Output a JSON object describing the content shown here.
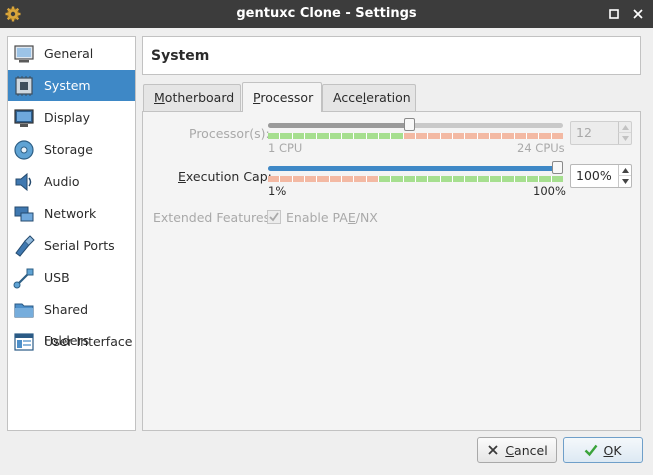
{
  "window": {
    "title": "gentuxc Clone - Settings"
  },
  "sidebar": {
    "items": [
      {
        "label": "General",
        "icon": "general-icon"
      },
      {
        "label": "System",
        "icon": "system-icon",
        "selected": true
      },
      {
        "label": "Display",
        "icon": "display-icon"
      },
      {
        "label": "Storage",
        "icon": "storage-icon"
      },
      {
        "label": "Audio",
        "icon": "audio-icon"
      },
      {
        "label": "Network",
        "icon": "network-icon"
      },
      {
        "label": "Serial Ports",
        "icon": "serial-ports-icon"
      },
      {
        "label": "USB",
        "icon": "usb-icon"
      },
      {
        "label": "Shared Folders",
        "icon": "shared-folders-icon"
      },
      {
        "label": "User Interface",
        "icon": "user-interface-icon"
      }
    ]
  },
  "page": {
    "title": "System"
  },
  "tabs": [
    {
      "label_pre": "",
      "label_mn": "M",
      "label_post": "otherboard",
      "active": false
    },
    {
      "label_pre": "",
      "label_mn": "P",
      "label_post": "rocessor",
      "active": true
    },
    {
      "label_pre": "Acce",
      "label_mn": "l",
      "label_post": "eration",
      "active": false
    }
  ],
  "processor": {
    "label": "Processor(s):",
    "value": 12,
    "min_label": "1 CPU",
    "max_label": "24 CPUs",
    "min": 1,
    "max": 24,
    "recommended_max": 12,
    "enabled": false
  },
  "execution_cap": {
    "label_pre": "",
    "label_mn": "E",
    "label_post": "xecution Cap:",
    "value_text": "100%",
    "value": 100,
    "min_label": "1%",
    "max_label": "100%",
    "min": 1,
    "max": 100,
    "warning_below": 40
  },
  "extended_features": {
    "label": "Extended Features:",
    "checkbox_label_pre": "Enable PA",
    "checkbox_label_mn": "E",
    "checkbox_label_post": "/NX",
    "checked": true,
    "enabled": false
  },
  "buttons": {
    "cancel": {
      "label_pre": "",
      "label_mn": "C",
      "label_post": "ancel"
    },
    "ok": {
      "label_pre": "",
      "label_mn": "O",
      "label_post": "K"
    }
  },
  "colors": {
    "accent": "#3e88c6",
    "titlebar": "#3c3c3c",
    "tick_ok": "#a6df8f",
    "tick_warn": "#f3b9a3",
    "cap_groove": "#3e88c6"
  }
}
